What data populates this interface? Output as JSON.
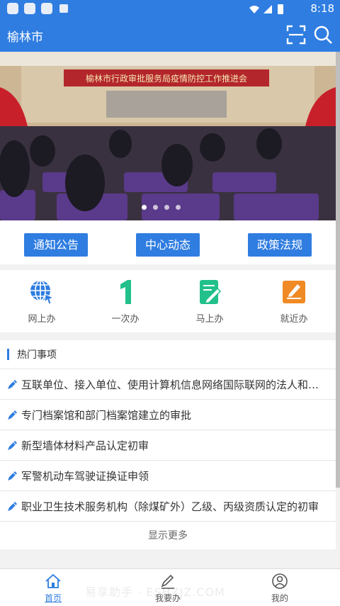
{
  "status_bar": {
    "time": "8:18"
  },
  "app_bar": {
    "title": "榆林市",
    "icons": [
      "scan-icon",
      "search-icon"
    ]
  },
  "banner": {
    "headline": "榆林市行政审批服务局疫情防控工作推进会",
    "slide_count": 4,
    "active_slide": 0
  },
  "tabs": [
    {
      "label": "通知公告"
    },
    {
      "label": "中心动态"
    },
    {
      "label": "政策法规"
    }
  ],
  "quick_actions": [
    {
      "label": "网上办",
      "icon": "globe-icon",
      "color": "#2f7de1"
    },
    {
      "label": "一次办",
      "icon": "number-one-icon",
      "color": "#22c08a"
    },
    {
      "label": "马上办",
      "icon": "document-pen-icon",
      "color": "#22c08a"
    },
    {
      "label": "就近办",
      "icon": "edit-box-icon",
      "color": "#f08a24"
    }
  ],
  "hot_items": {
    "title": "热门事项",
    "items": [
      "互联单位、接入单位、使用计算机信息网络国际联网的法人和…",
      "专门档案馆和部门档案馆建立的审批",
      "新型墙体材料产品认定初审",
      "军警机动车驾驶证换证申领",
      "职业卫生技术服务机构（除煤矿外）乙级、丙级资质认定的初审"
    ],
    "more_label": "显示更多"
  },
  "bottom_nav": [
    {
      "label": "首页",
      "icon": "home-icon",
      "active": true
    },
    {
      "label": "我要办",
      "icon": "pen-icon",
      "active": false
    },
    {
      "label": "我的",
      "icon": "user-icon",
      "active": false
    }
  ],
  "watermark": "易享助手 · ESHZJZ.COM",
  "accent_color": "#2f7de1"
}
